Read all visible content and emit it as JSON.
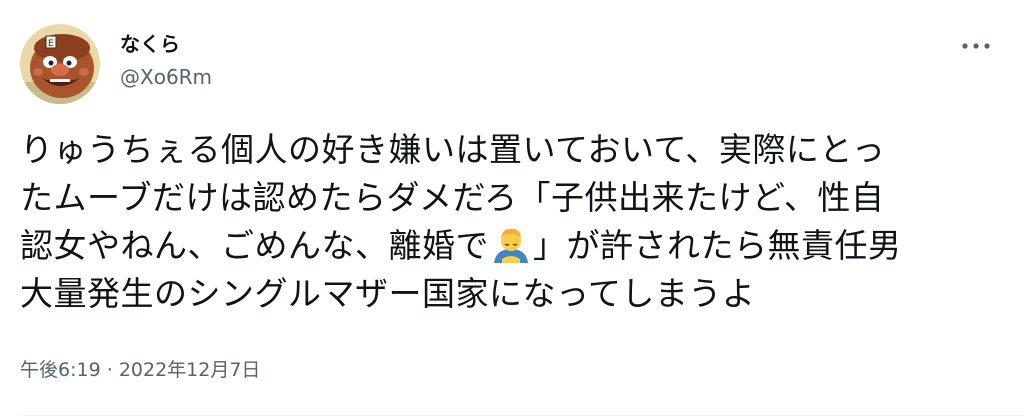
{
  "author": {
    "display_name": "なくら",
    "handle": "@Xo6Rm",
    "avatar_icon": "cartoon-face-avatar"
  },
  "actions": {
    "more_icon": "more-dots-icon"
  },
  "tweet": {
    "lines": [
      "りゅうちぇる個人の好き嫌いは置いておいて、実際にとっ",
      "たムーブだけは認めたらダメだろ「子供出来たけど、性自",
      "認女やねん、ごめんな、離婚で",
      "」が許されたら無責任男",
      "大量発生のシングルマザー国家になってしまうよ"
    ],
    "emoji": "person-bowing-emoji"
  },
  "meta": {
    "time": "午後6:19",
    "separator": "·",
    "date": "2022年12月7日"
  },
  "colors": {
    "text": "#0f1419",
    "secondary": "#536471",
    "divider": "#eff3f4"
  }
}
